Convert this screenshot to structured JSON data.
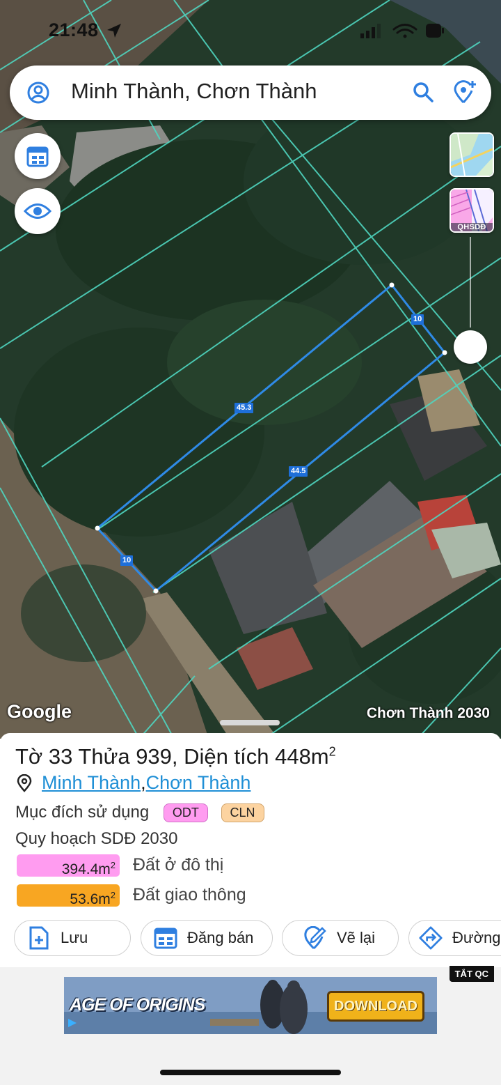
{
  "status_bar": {
    "time": "21:48"
  },
  "search": {
    "query": "Minh Thành, Chơn Thành"
  },
  "map": {
    "attribution": "Google",
    "plan_label": "Chơn Thành 2030",
    "layer_qhsdd_label": "QHSDĐ",
    "parcel_dimensions": {
      "top_edge": "45.3",
      "bottom_edge": "44.5",
      "right_edge": "10",
      "left_edge": "10"
    },
    "parcel_outline_color": "#2f8ae6",
    "cadastral_line_color": "#4fd6c0"
  },
  "parcel": {
    "title_prefix": "Tờ 33 Thửa 939, Diện tích 448m",
    "title_sup": "2",
    "commune": "Minh Thành",
    "separator": ", ",
    "district": "Chơn Thành",
    "usage_label": "Mục đích sử dụng",
    "usage_tags": [
      {
        "code": "ODT",
        "color": "#ff9cf0"
      },
      {
        "code": "CLN",
        "color": "#fcd3a0"
      }
    ],
    "plan_label": "Quy hoạch SDĐ 2030",
    "plan_items": [
      {
        "area": "394.4m",
        "unit_sup": "2",
        "label": "Đất ở đô thị",
        "color": "#ff9cf0"
      },
      {
        "area": "53.6m",
        "unit_sup": "2",
        "label": "Đất giao thông",
        "color": "#f8a622"
      }
    ]
  },
  "actions": [
    {
      "label": "Lưu",
      "icon": "add-document-icon"
    },
    {
      "label": "Đăng bán",
      "icon": "calendar-icon"
    },
    {
      "label": "Vẽ lại",
      "icon": "redraw-icon"
    },
    {
      "label": "Đường",
      "icon": "directions-icon"
    }
  ],
  "ad": {
    "close_label": "TẮT QC",
    "game_name": "AGE OF ORIGINS",
    "cta": "DOWNLOAD"
  }
}
